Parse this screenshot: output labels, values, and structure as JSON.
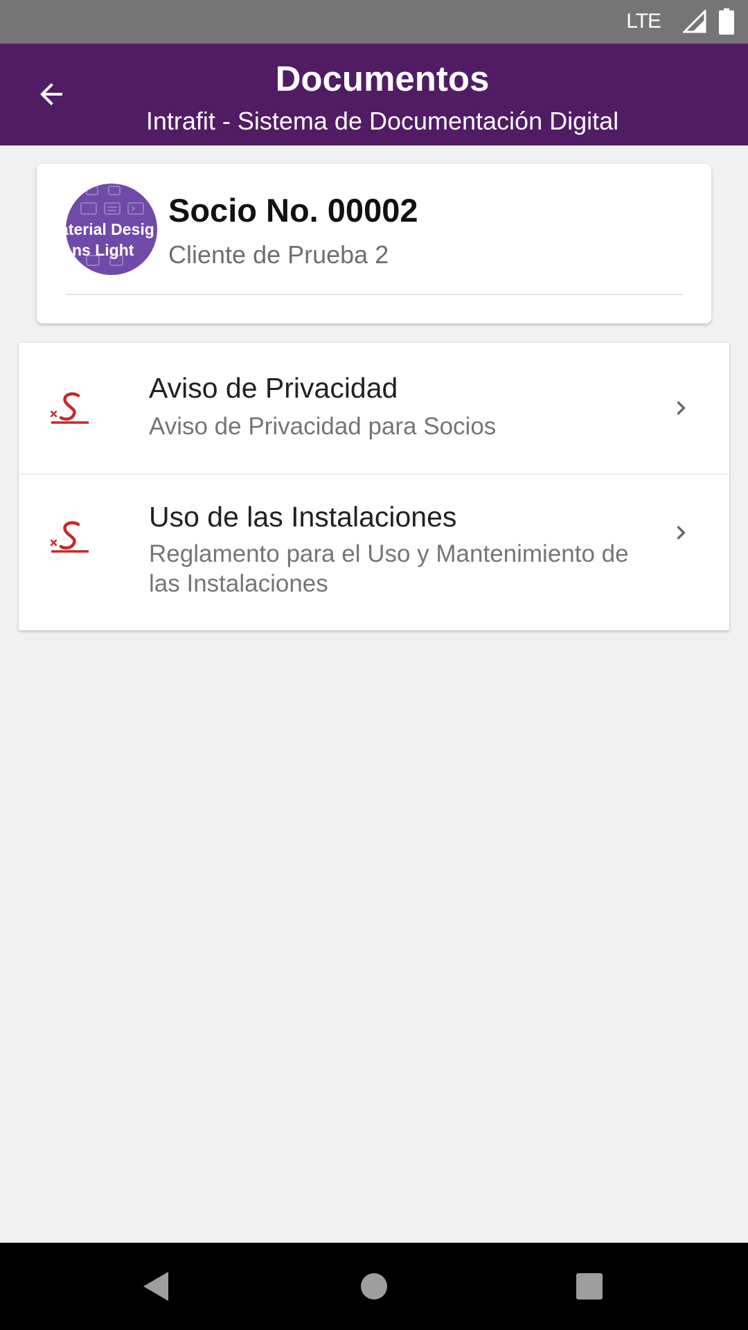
{
  "status_bar": {
    "network": "LTE",
    "icons": [
      "signal-icon",
      "battery-icon"
    ]
  },
  "app_bar": {
    "title": "Documentos",
    "subtitle": "Intrafit - Sistema de Documentación Digital",
    "back_icon": "arrow-back-icon"
  },
  "member": {
    "number": "Socio No. 00002",
    "name": "Cliente de Prueba 2",
    "avatar": {
      "line1": "aterial Desig",
      "line2": "ns Light"
    }
  },
  "documents": [
    {
      "title": "Aviso de Privacidad",
      "description": "Aviso de Privacidad para Socios",
      "icon": "signature-icon"
    },
    {
      "title": "Uso de las Instalaciones",
      "description": "Reglamento para el Uso y Mantenimiento de las Instalaciones",
      "icon": "signature-icon"
    }
  ],
  "nav_bar": {
    "icons": [
      "nav-back-icon",
      "nav-home-icon",
      "nav-recents-icon"
    ]
  },
  "colors": {
    "app_bar": "#511c63",
    "status_bar": "#757575",
    "avatar": "#6f4aa8",
    "signature_icon": "#c62828",
    "background": "#f1f1f1"
  }
}
